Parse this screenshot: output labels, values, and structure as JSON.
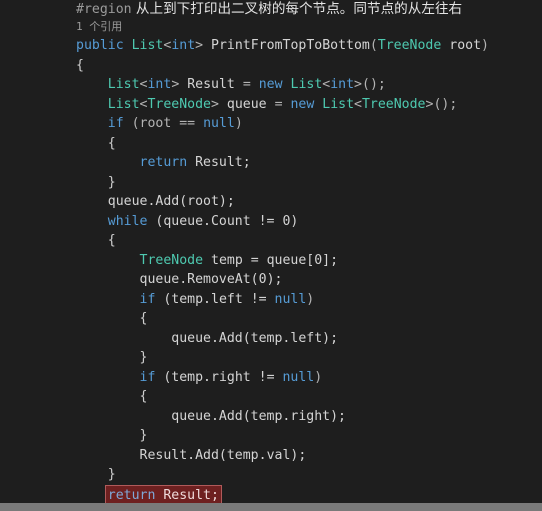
{
  "editor": {
    "background_color": "#1e1e1e",
    "foreground_color": "#d4d4d4",
    "language": "csharp",
    "theme": "dark"
  },
  "colors": {
    "keyword": "#569cd6",
    "type": "#4ec9b0",
    "identifier": "#d4d4d4",
    "punctuation": "#b4b4b4",
    "comment": "#dcdcdc",
    "preprocessor": "#9b9b9b",
    "codelens": "#9a9a9a",
    "highlight_background": "#6e2020",
    "highlight_border": "#b05a5a",
    "scrollbar": "#7a7a7a"
  },
  "region": {
    "directive": "#region",
    "comment": "从上到下打印出二叉树的每个节点。同节点的从左往右"
  },
  "codelens": {
    "count": "1",
    "label": "个引用"
  },
  "code": {
    "signature": {
      "modifier": "public",
      "return_type": "List",
      "return_type_open": "<",
      "return_type_arg": "int",
      "return_type_close": ">",
      "method_name": "PrintFromTopToBottom",
      "paren_open": "(",
      "param_type": "TreeNode",
      "param_name": "root",
      "paren_close": ")"
    },
    "brace_open": "{",
    "brace_close": "}",
    "decl_result": {
      "type": "List",
      "lt": "<",
      "generic": "int",
      "gt": ">",
      "name": "Result",
      "eq": "=",
      "new_kw": "new",
      "ctor": "List",
      "ctor_lt": "<",
      "ctor_generic": "int",
      "ctor_gt": ">",
      "tail": "();"
    },
    "decl_queue": {
      "type": "List",
      "lt": "<",
      "generic": "TreeNode",
      "gt": ">",
      "name": "queue",
      "eq": "=",
      "new_kw": "new",
      "ctor": "List",
      "ctor_lt": "<",
      "ctor_generic": "TreeNode",
      "ctor_gt": ">",
      "tail": "();"
    },
    "if_root_null": {
      "keyword": "if",
      "expr_open": " (root == ",
      "null_kw": "null",
      "expr_close": ")"
    },
    "return_result_early": {
      "keyword": "return",
      "value": " Result;"
    },
    "queue_add_root": "queue.Add(root);",
    "while_loop": {
      "keyword": "while",
      "expr": " (queue.Count != 0)"
    },
    "temp_decl": {
      "type": "TreeNode",
      "rest": " temp = queue[0];"
    },
    "queue_removeat": "queue.RemoveAt(0);",
    "if_left_null": {
      "keyword": "if",
      "expr_open": " (temp.left != ",
      "null_kw": "null",
      "expr_close": ")"
    },
    "queue_add_left": "queue.Add(temp.left);",
    "if_right_null": {
      "keyword": "if",
      "expr_open": " (temp.right != ",
      "null_kw": "null",
      "expr_close": ")"
    },
    "queue_add_right": "queue.Add(temp.right);",
    "result_add_val": "Result.Add(temp.val);",
    "return_result_final": {
      "keyword": "return",
      "value": " Result;"
    }
  }
}
